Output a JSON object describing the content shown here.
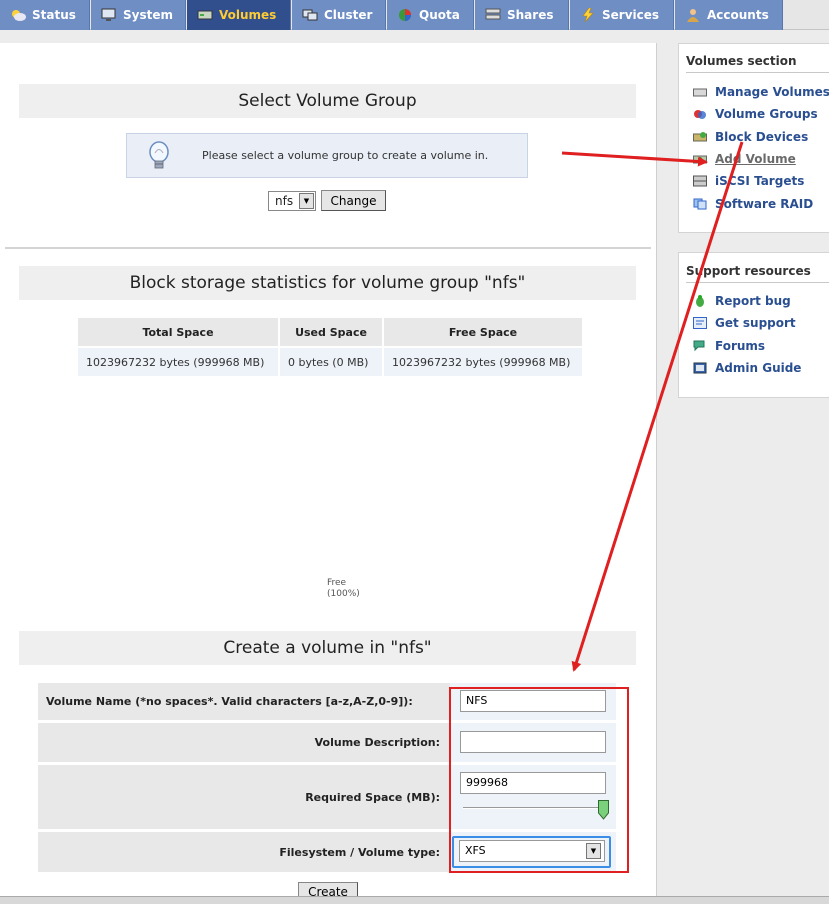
{
  "nav": {
    "tabs": [
      {
        "label": "Status",
        "icon": "weather-icon"
      },
      {
        "label": "System",
        "icon": "monitor-icon"
      },
      {
        "label": "Volumes",
        "icon": "drive-icon",
        "active": true
      },
      {
        "label": "Cluster",
        "icon": "cluster-icon"
      },
      {
        "label": "Quota",
        "icon": "quota-icon"
      },
      {
        "label": "Shares",
        "icon": "shares-icon"
      },
      {
        "label": "Services",
        "icon": "lightning-icon"
      },
      {
        "label": "Accounts",
        "icon": "user-icon"
      }
    ],
    "active_color": "#304f8c",
    "active_text_color": "#ffcc33",
    "tab_color": "#6f8ec4"
  },
  "select_vg": {
    "title": "Select Volume Group",
    "hint": "Please select a volume group to create a volume in.",
    "selected_vg": "nfs",
    "change_button": "Change"
  },
  "stats": {
    "title": "Block storage statistics for volume group \"nfs\"",
    "headers": [
      "Total Space",
      "Used Space",
      "Free Space"
    ],
    "row": [
      "1023967232 bytes (999968 MB)",
      "0 bytes (0 MB)",
      "1023967232 bytes (999968 MB)"
    ],
    "chart_label_1": "Free",
    "chart_label_2": "(100%)"
  },
  "create": {
    "title": "Create a volume in \"nfs\"",
    "name_label": "Volume Name (*no spaces*. Valid characters [a-z,A-Z,0-9]):",
    "name_value": "NFS",
    "desc_label": "Volume Description:",
    "desc_value": "",
    "space_label": "Required Space (MB):",
    "space_value": "999968",
    "space_slider_fraction": 1.0,
    "fs_label": "Filesystem / Volume type:",
    "fs_value": "XFS",
    "create_button": "Create"
  },
  "sidebar": {
    "volumes_title": "Volumes section",
    "volumes_items": [
      {
        "label": "Manage Volumes",
        "icon": "drive-icon"
      },
      {
        "label": "Volume Groups",
        "icon": "volume-groups-icon"
      },
      {
        "label": "Block Devices",
        "icon": "block-devices-icon"
      },
      {
        "label": "Add Volume",
        "icon": "add-volume-icon",
        "current": true
      },
      {
        "label": "iSCSI Targets",
        "icon": "iscsi-icon"
      },
      {
        "label": "Software RAID",
        "icon": "raid-icon"
      }
    ],
    "support_title": "Support resources",
    "support_items": [
      {
        "label": "Report bug",
        "icon": "bug-icon"
      },
      {
        "label": "Get support",
        "icon": "support-icon"
      },
      {
        "label": "Forums",
        "icon": "forums-icon"
      },
      {
        "label": "Admin Guide",
        "icon": "book-icon"
      }
    ]
  },
  "annotation_color": "#e02020",
  "highlight_color": "#3a8ee6"
}
